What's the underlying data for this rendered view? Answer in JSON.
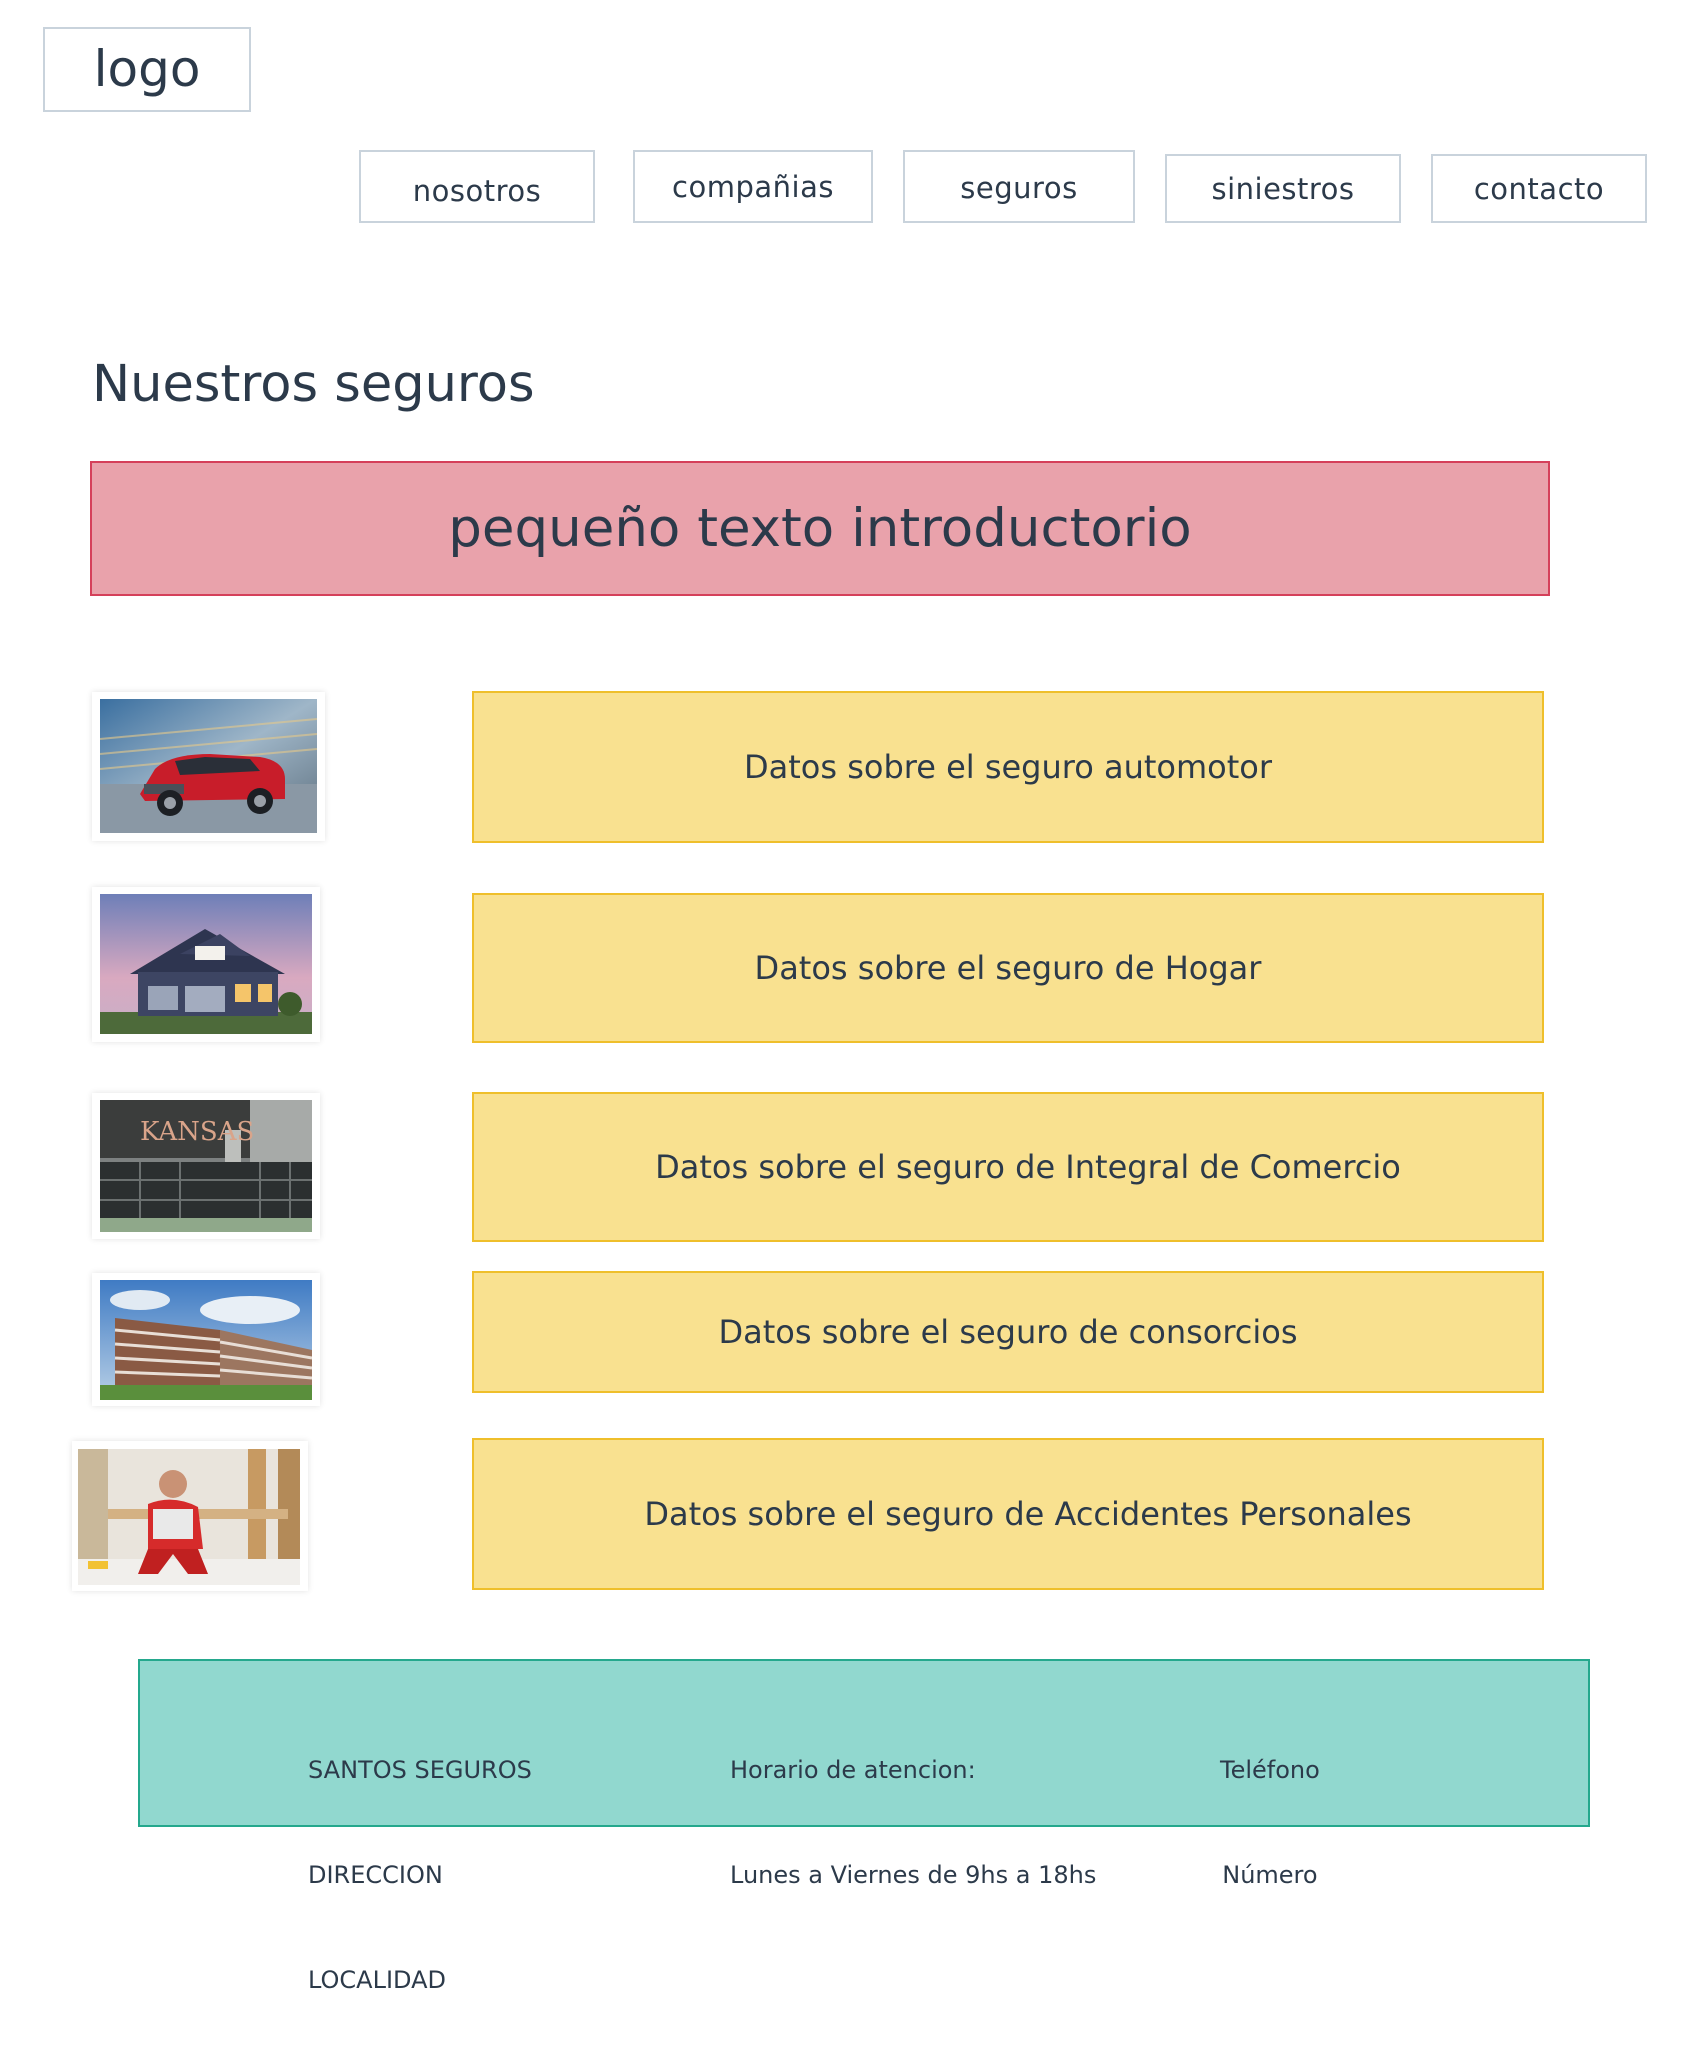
{
  "header": {
    "logo_text": "logo"
  },
  "nav": {
    "items": [
      {
        "label": "nosotros"
      },
      {
        "label": "compañias"
      },
      {
        "label": "seguros"
      },
      {
        "label": "siniestros"
      },
      {
        "label": "contacto"
      }
    ]
  },
  "main": {
    "title": "Nuestros seguros",
    "intro": "pequeño texto introductorio",
    "insurances": [
      {
        "label": "Datos sobre el seguro automotor",
        "image_icon": "red-suv-photo"
      },
      {
        "label": "Datos sobre el seguro de Hogar",
        "image_icon": "house-photo"
      },
      {
        "label": "Datos sobre el seguro de Integral de Comercio",
        "image_icon": "storefront-photo",
        "image_text": "KANSAS"
      },
      {
        "label": "Datos sobre el seguro de consorcios",
        "image_icon": "apartment-building-photo"
      },
      {
        "label": "Datos sobre el seguro de Accidentes Personales",
        "image_icon": "injured-worker-photo"
      }
    ]
  },
  "footer": {
    "company": {
      "line1": "SANTOS SEGUROS",
      "line2": "DIRECCION",
      "line3": "LOCALIDAD"
    },
    "hours": {
      "line1": "Horario de atencion:",
      "line2": "Lunes a Viernes de 9hs a 18hs"
    },
    "phone": {
      "line1": "Teléfono",
      "line2": "Número"
    }
  },
  "colors": {
    "intro_bg": "#e9a2ab",
    "intro_border": "#d5405a",
    "card_bg": "#f9e190",
    "card_border": "#efbf2b",
    "footer_bg": "#91d8cf",
    "footer_border": "#24a88d",
    "nav_border": "#c9d3dc",
    "text": "#2c3a4a"
  }
}
